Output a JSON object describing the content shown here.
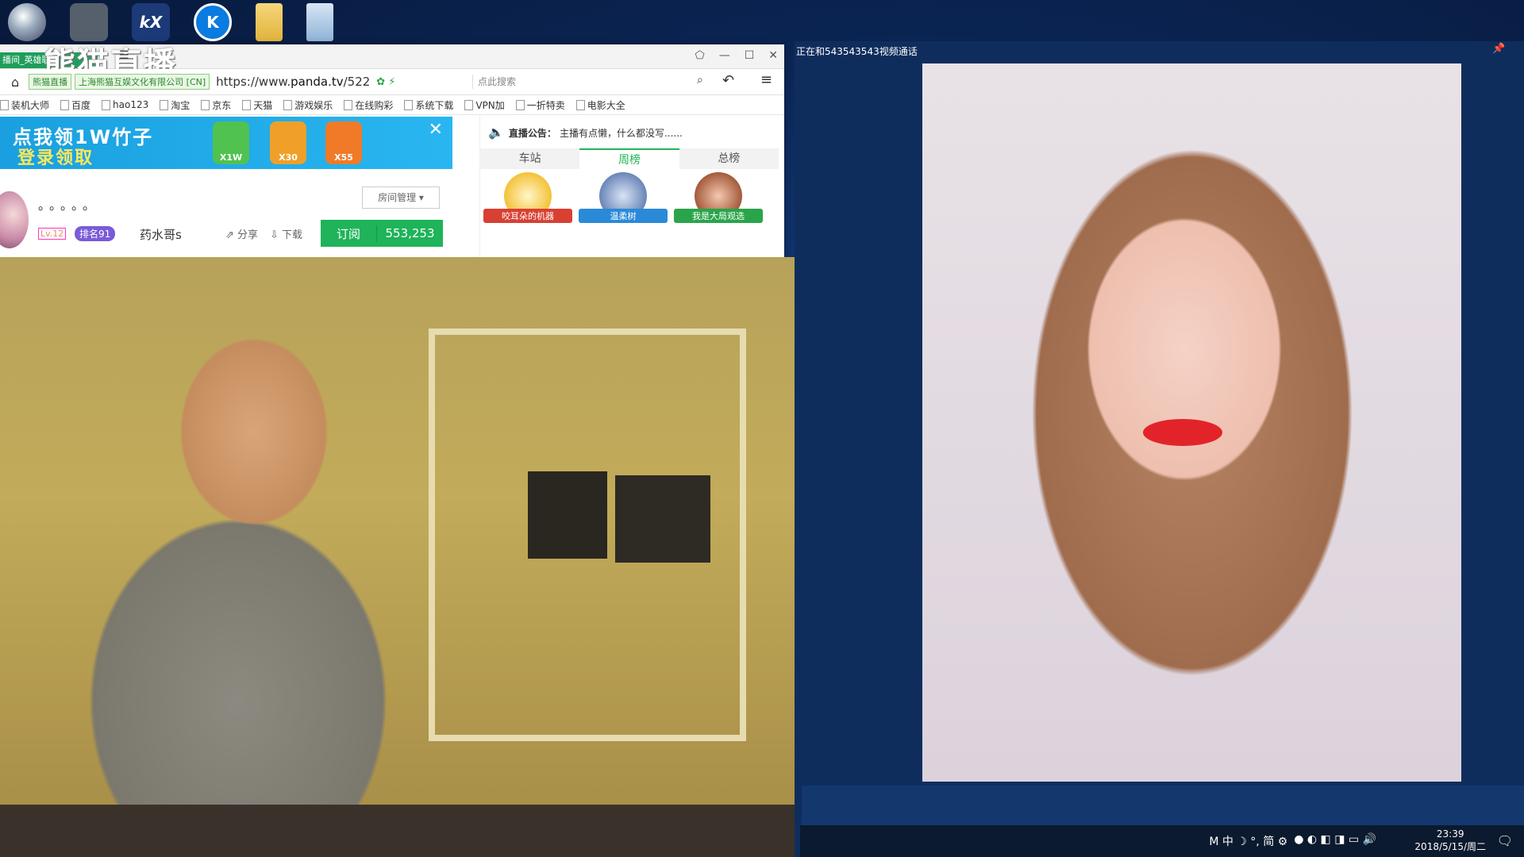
{
  "browser": {
    "tab_title": "播间_英雄联盟",
    "logo_text": "熊猫直播",
    "site_badge": "熊猫直播",
    "cert_badge": "上海熊猫互娱文化有限公司 [CN]",
    "url_prefix": "https://www.",
    "url_domain": "panda.tv",
    "url_path": "/522",
    "search_placeholder": "点此搜索",
    "bookmarks": [
      "装机大师",
      "百度",
      "hao123",
      "淘宝",
      "京东",
      "天猫",
      "游戏娱乐",
      "在线购彩",
      "系统下载",
      "VPN加",
      "一折特卖",
      "电影大全"
    ]
  },
  "banner": {
    "line1": "点我领1W竹子",
    "line2": "登录领取",
    "prizes": [
      "X1W",
      "X30",
      "X55"
    ]
  },
  "streamer": {
    "name_dots": "。。。。。",
    "room_mgmt": "房间管理",
    "level": "Lv.12",
    "rank": "排名91",
    "host": "药水哥s",
    "share": "分享",
    "download": "下载",
    "subscribe_label": "订阅",
    "subscribe_count": "553,253"
  },
  "panel": {
    "notice_label": "直播公告：",
    "notice_text": "主播有点懒，什么都没写......",
    "tabs": [
      "车站",
      "周榜",
      "总榜"
    ],
    "active_tab": 1,
    "ranks": [
      "咬耳朵的机器",
      "温柔树",
      "我是大局观选"
    ]
  },
  "call": {
    "title": "正在和543543543视频通话"
  },
  "taskbar": {
    "ime": "M 中 ☽ °, 简 ⚙",
    "time": "23:39",
    "date": "2018/5/15/周二"
  },
  "colors": {
    "accent_green": "#1fb35a",
    "desktop_blue": "#0a2350"
  }
}
